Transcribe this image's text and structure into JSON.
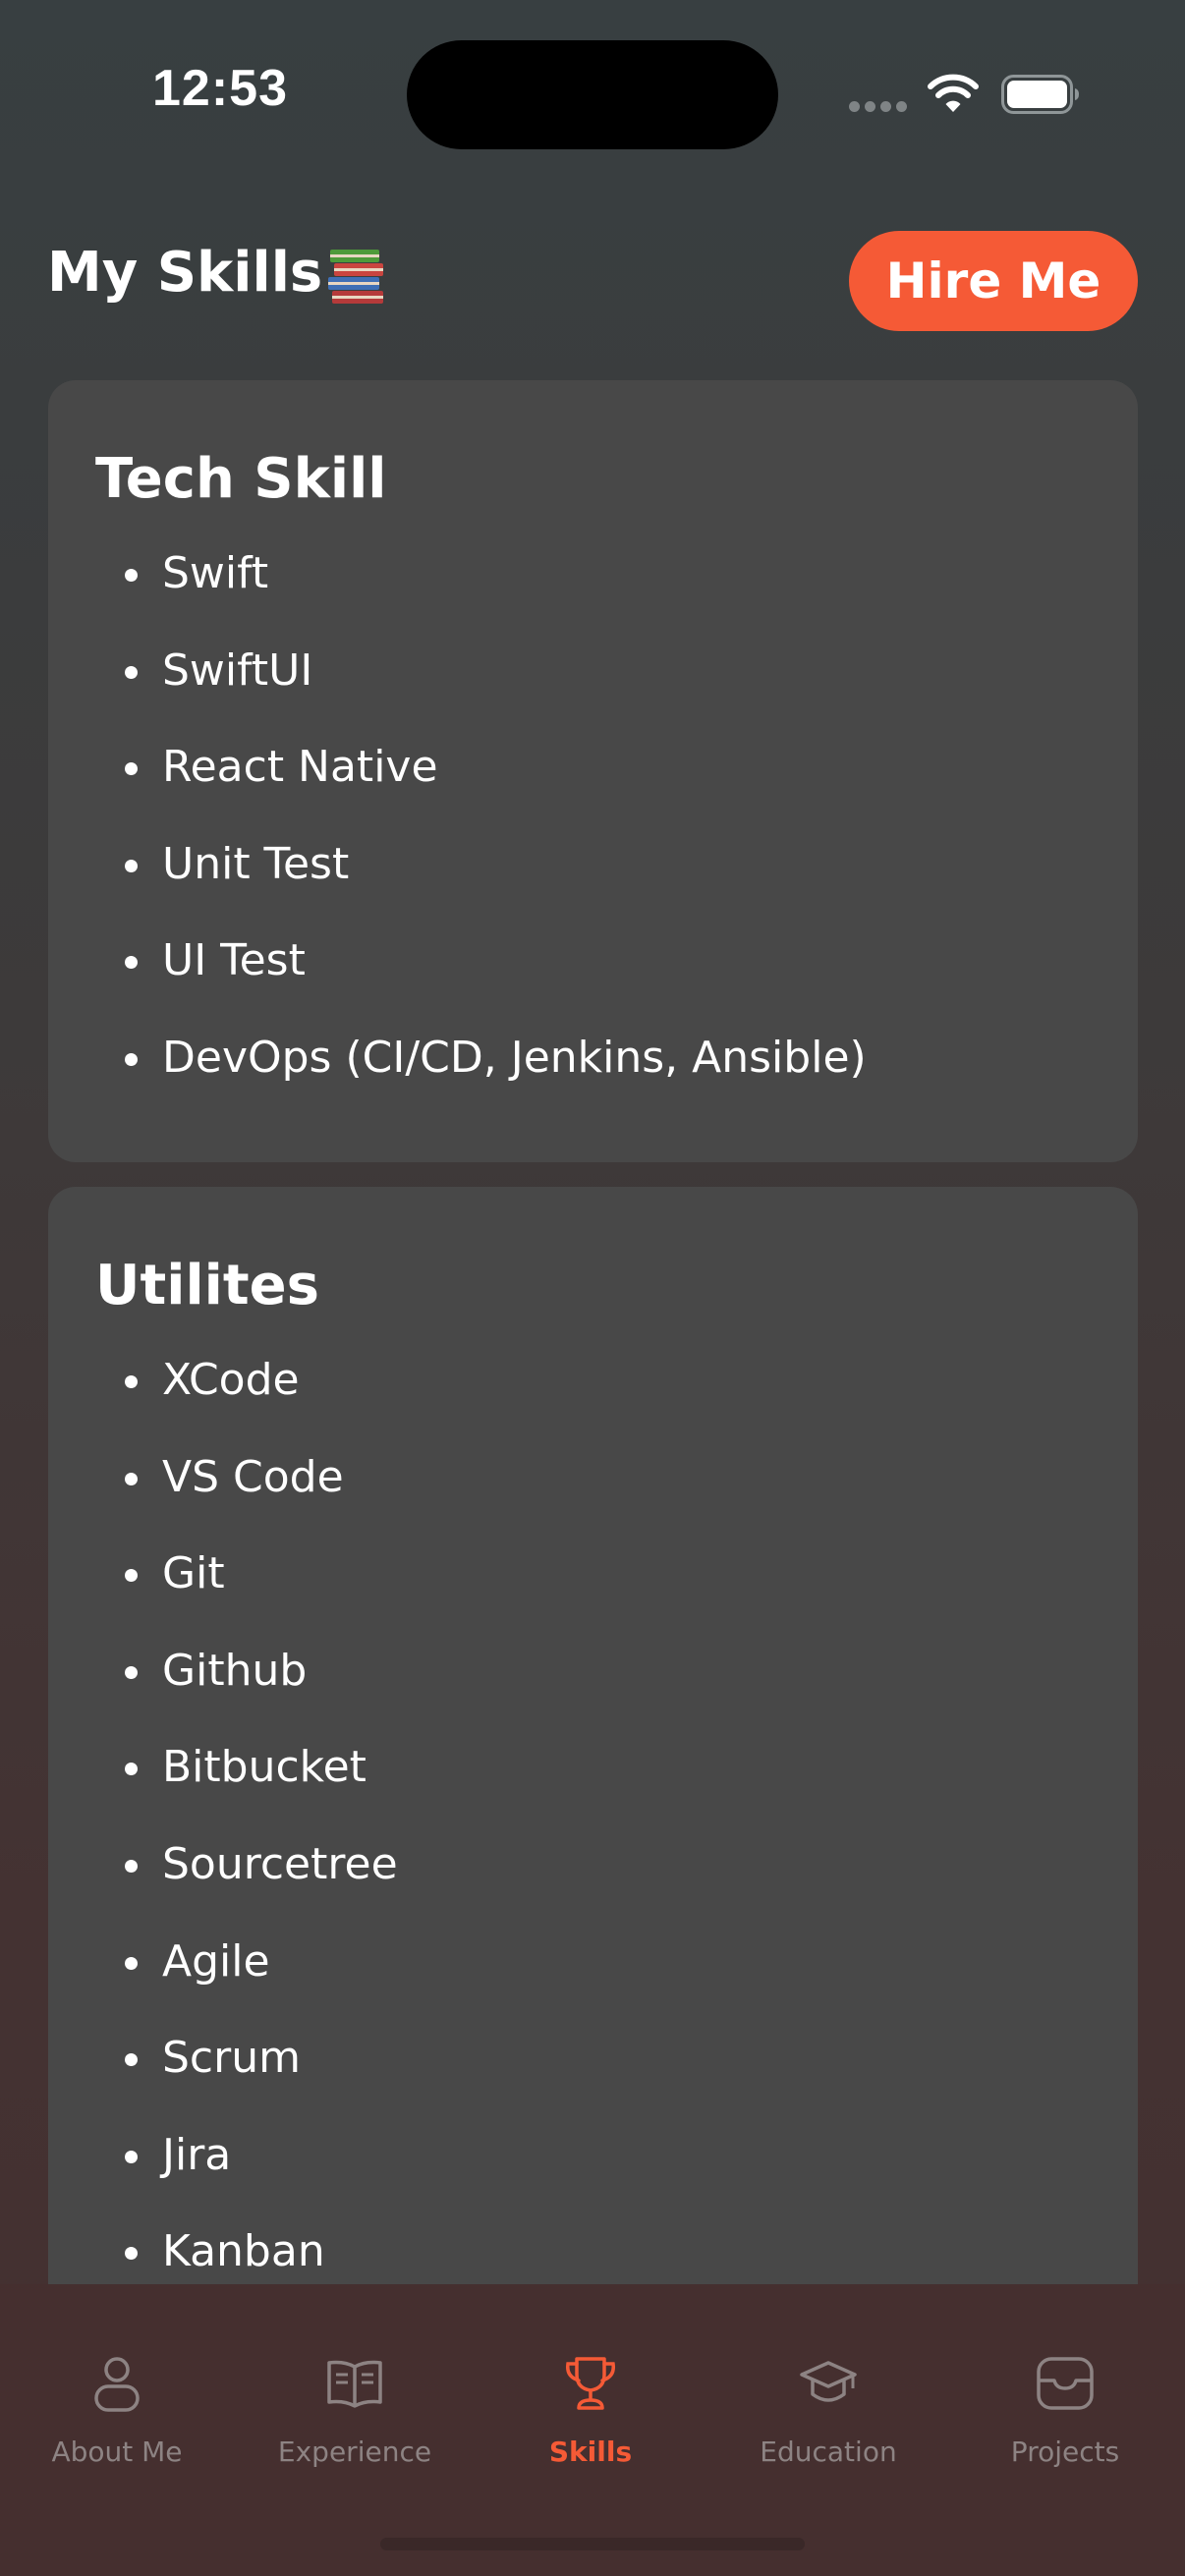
{
  "status_bar": {
    "time": "12:53"
  },
  "header": {
    "title": "My Skills",
    "title_icon": "books-icon",
    "hire_button_label": "Hire Me"
  },
  "sections": [
    {
      "title": "Tech Skill",
      "items": [
        "Swift",
        "SwiftUI",
        "React Native",
        "Unit Test",
        "UI Test",
        "DevOps (CI/CD, Jenkins, Ansible)"
      ]
    },
    {
      "title": "Utilites",
      "items": [
        "XCode",
        "VS Code",
        "Git",
        "Github",
        "Bitbucket",
        "Sourcetree",
        "Agile",
        "Scrum",
        "Jira",
        "Kanban"
      ]
    }
  ],
  "tab_bar": {
    "tabs": [
      {
        "label": "About Me",
        "icon": "person-icon"
      },
      {
        "label": "Experience",
        "icon": "book-open-icon"
      },
      {
        "label": "Skills",
        "icon": "trophy-icon"
      },
      {
        "label": "Education",
        "icon": "graduation-cap-icon"
      },
      {
        "label": "Projects",
        "icon": "tray-icon"
      }
    ],
    "active_tab": "Skills"
  },
  "colors": {
    "accent": "#f55a36",
    "card_background": "#484848",
    "tab_inactive": "#8d8383",
    "tab_bar_background": "#452f2f"
  }
}
